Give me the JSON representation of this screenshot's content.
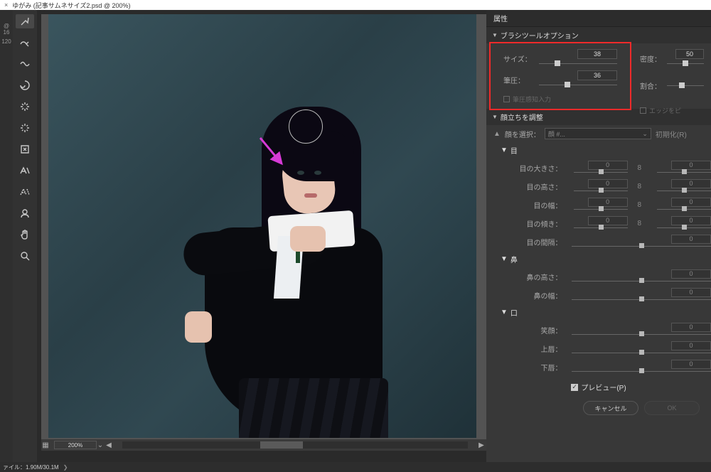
{
  "tab": {
    "title": "ゆがみ (記事サムネサイズ2.psd @ 200%)"
  },
  "leftpad": {
    "a": "@ 16",
    "b": "120"
  },
  "zoom": {
    "value": "200%"
  },
  "status": {
    "info": "ァイル：1.90M/30.1M"
  },
  "panel": {
    "header": "属性",
    "brush": {
      "title": "ブラシツールオプション",
      "size_label": "サイズ：",
      "size_val": "38",
      "pressure_label": "筆圧：",
      "pressure_val": "36",
      "density_label": "密度：",
      "density_val": "50",
      "rate_label": "割合：",
      "pen_pressure": "筆圧感知入力",
      "edge_pin": "エッジをピ"
    },
    "face": {
      "title": "顔立ちを調整",
      "select_label": "顔を選択：",
      "select_value": "顔 #...",
      "init": "初期化(R)",
      "eye_head": "目",
      "eye_size": "目の大きさ：",
      "eye_height": "目の高さ：",
      "eye_width": "目の幅：",
      "eye_tilt": "目の傾き：",
      "eye_gap": "目の間隔：",
      "nose_head": "鼻",
      "nose_height": "鼻の高さ：",
      "nose_width": "鼻の幅：",
      "mouth_head": "口",
      "smile": "笑顔：",
      "upper_lip": "上唇：",
      "lower_lip": "下唇：",
      "zero": "0",
      "link": "8"
    },
    "preview": "プレビュー(P)",
    "cancel": "キャンセル",
    "ok": "OK"
  }
}
